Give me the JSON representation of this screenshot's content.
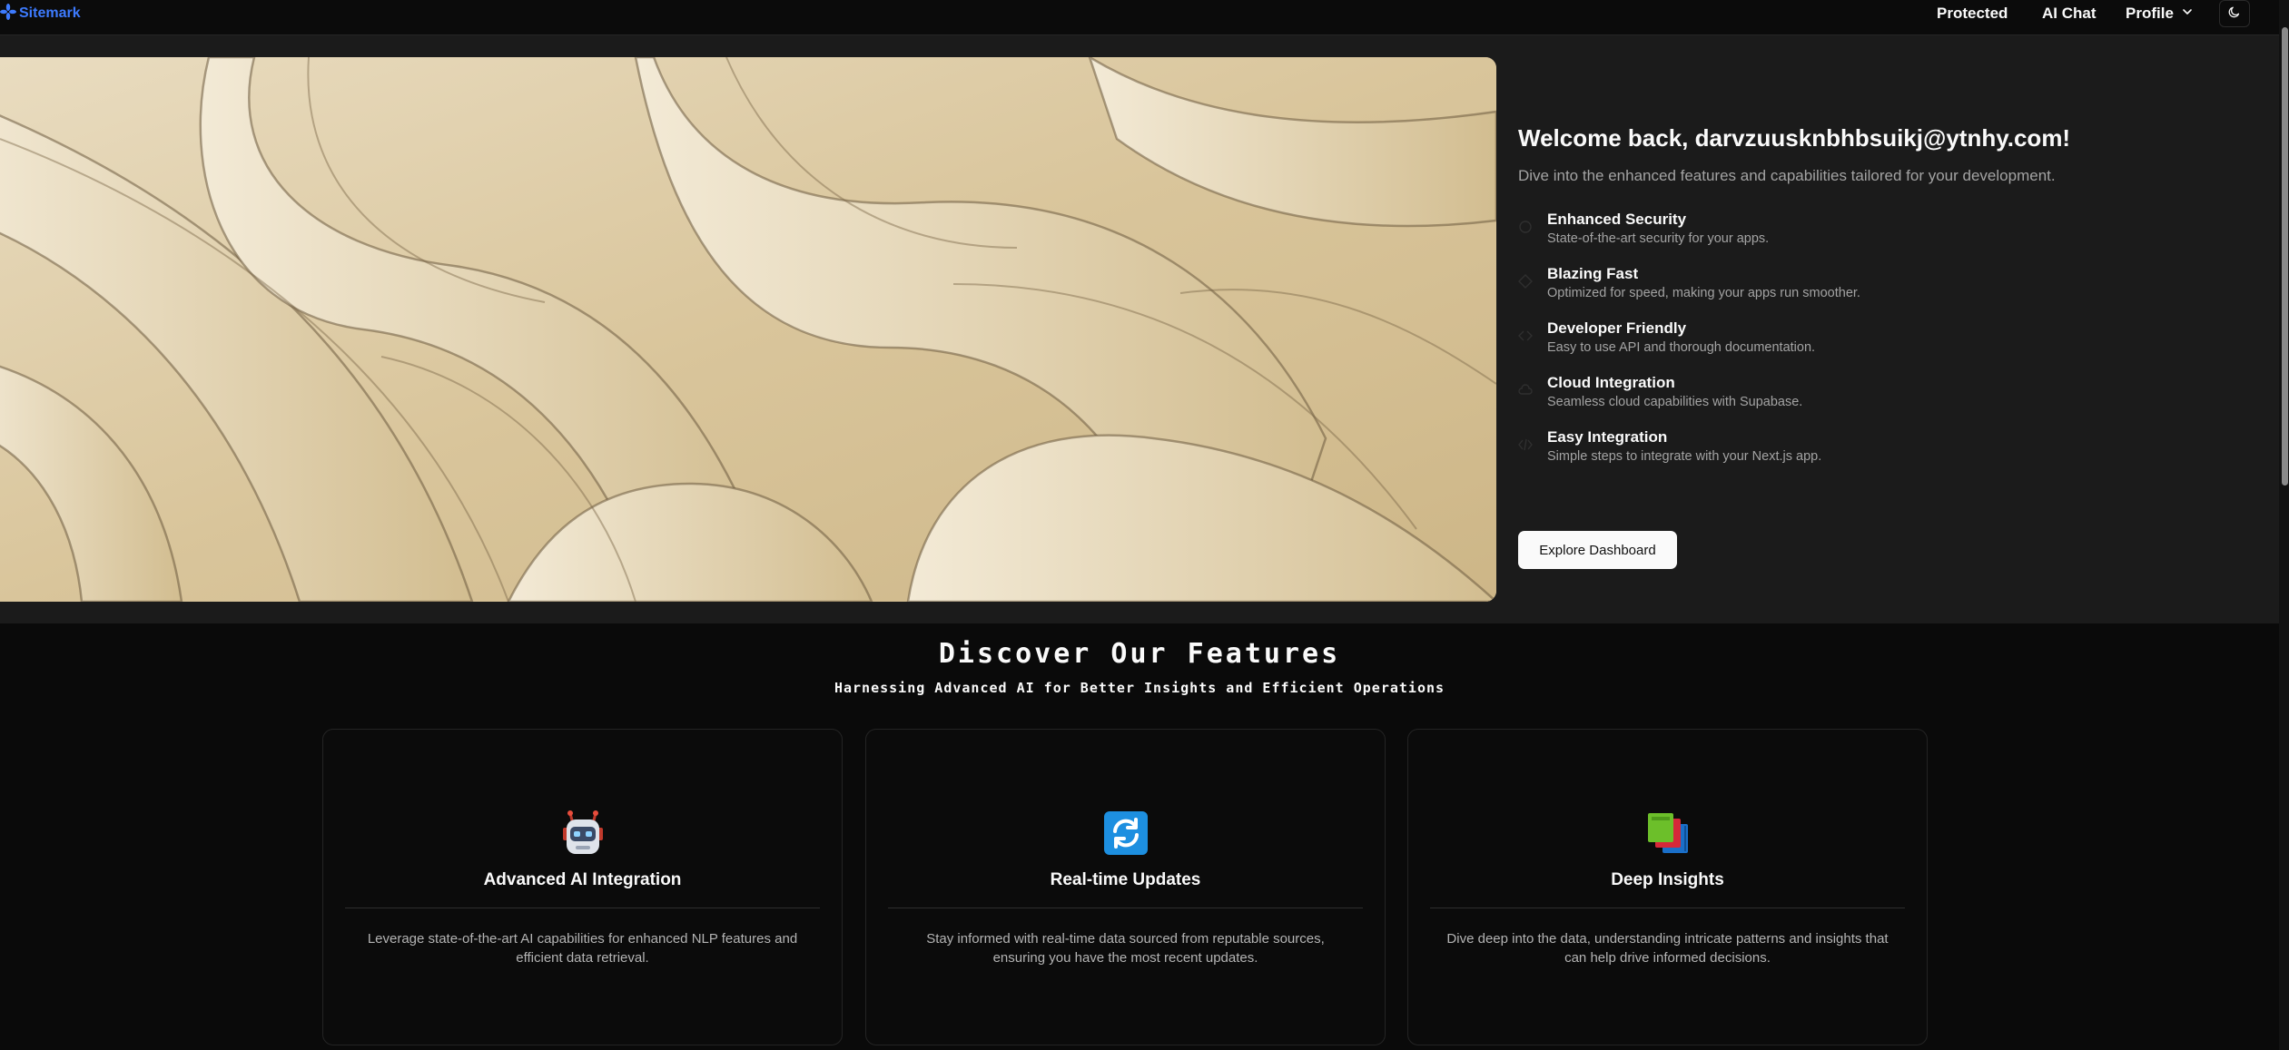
{
  "nav": {
    "brand": "Sitemark",
    "links": [
      {
        "label": "Protected"
      },
      {
        "label": "AI Chat"
      }
    ],
    "profile_label": "Profile",
    "icons": {
      "brand": "sitemark-logo-icon",
      "profile_caret": "chevron-down-icon",
      "theme": "moon-icon"
    }
  },
  "hero": {
    "welcome": "Welcome back, darvzuusknbhbsuikj@ytnhy.com!",
    "subtitle": "Dive into the enhanced features and capabilities tailored for your development.",
    "features": [
      {
        "title": "Enhanced Security",
        "desc": "State-of-the-art security for your apps.",
        "icon": "shield-icon"
      },
      {
        "title": "Blazing Fast",
        "desc": "Optimized for speed, making your apps run smoother.",
        "icon": "zap-icon"
      },
      {
        "title": "Developer Friendly",
        "desc": "Easy to use API and thorough documentation.",
        "icon": "code-icon"
      },
      {
        "title": "Cloud Integration",
        "desc": "Seamless cloud capabilities with Supabase.",
        "icon": "cloud-icon"
      },
      {
        "title": "Easy Integration",
        "desc": "Simple steps to integrate with your Next.js app.",
        "icon": "code-brackets-icon"
      }
    ],
    "cta": "Explore Dashboard"
  },
  "section": {
    "title": "Discover Our Features",
    "subtitle": "Harnessing Advanced AI for Better Insights and Efficient Operations",
    "cards": [
      {
        "title": "Advanced AI Integration",
        "desc": "Leverage state-of-the-art AI capabilities for enhanced NLP features and efficient data retrieval.",
        "icon": "robot-icon"
      },
      {
        "title": "Real-time Updates",
        "desc": "Stay informed with real-time data sourced from reputable sources, ensuring you have the most recent updates.",
        "icon": "refresh-icon"
      },
      {
        "title": "Deep Insights",
        "desc": "Dive deep into the data, understanding intricate patterns and insights that can help drive informed decisions.",
        "icon": "books-icon"
      }
    ]
  },
  "colors": {
    "background": "#0a0a0a",
    "hero_panel": "#1b1b1b",
    "brand": "#3d7bff",
    "muted_text": "#a3a3a3"
  }
}
